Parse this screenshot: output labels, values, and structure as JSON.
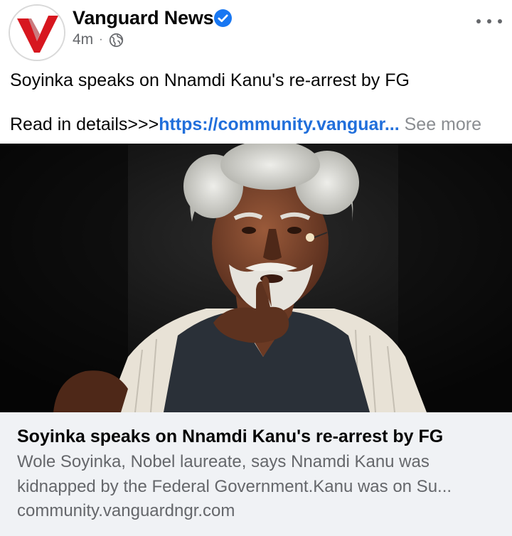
{
  "post": {
    "page_name": "Vanguard News",
    "verified_icon": "verified-badge-icon",
    "time": "4m",
    "separator": "·",
    "audience_icon": "globe-icon",
    "more_icon": "more-dots-icon",
    "headline": "Soyinka speaks on Nnamdi Kanu's re-arrest by FG",
    "read_prefix": "Read in details>>>",
    "link_text": "https://community.vanguar...",
    "see_more": "See more"
  },
  "link_preview": {
    "title": "Soyinka speaks on Nnamdi Kanu's re-arrest by FG",
    "description_line1": "Wole Soyinka, Nobel laureate, says Nnamdi Kanu was",
    "description_line2": "kidnapped by the Federal Government.Kanu was on Su...",
    "domain": "community.vanguardngr.com"
  },
  "colors": {
    "link": "#216fdb",
    "verified": "#1877f2",
    "logo_red": "#d7171f",
    "preview_bg": "#f0f2f5"
  }
}
